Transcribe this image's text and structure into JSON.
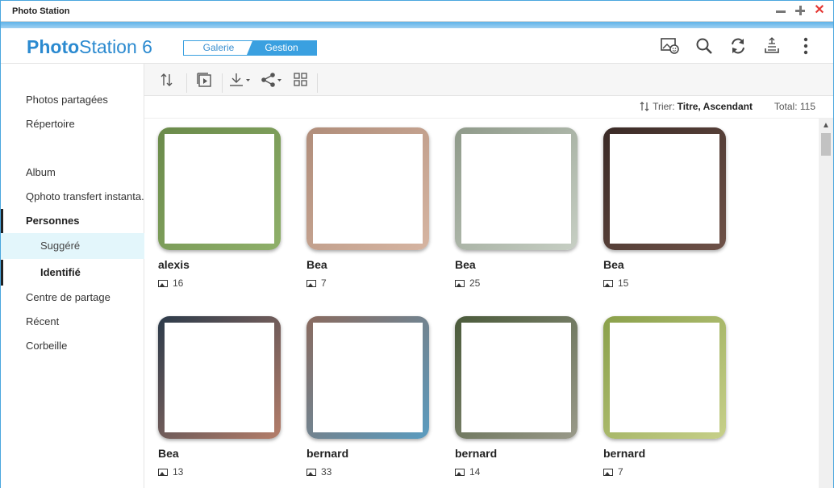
{
  "window": {
    "title": "Photo Station"
  },
  "header": {
    "logo_bold": "Photo",
    "logo_rest": "Station 6",
    "modes": [
      "Galerie",
      "Gestion"
    ],
    "active_mode": "Gestion",
    "icons": [
      "face-recognition-icon",
      "search-icon",
      "refresh-icon",
      "upload-icon",
      "more-vertical-icon"
    ]
  },
  "sidebar": {
    "items": [
      {
        "label": "Photos partagées"
      },
      {
        "label": "Répertoire"
      },
      {
        "label": "Album"
      },
      {
        "label": "Qphoto transfert instanta..."
      },
      {
        "label": "Personnes"
      },
      {
        "label": "Suggéré"
      },
      {
        "label": "Identifié"
      },
      {
        "label": "Centre de partage"
      },
      {
        "label": "Récent"
      },
      {
        "label": "Corbeille"
      }
    ]
  },
  "toolbar": {
    "icons": [
      "sort-icon",
      "slideshow-icon",
      "download-icon",
      "share-icon",
      "grid-view-icon"
    ]
  },
  "sortbar": {
    "sort_prefix": "Trier:",
    "sort_value": "Titre, Ascendant",
    "total": "Total: 115"
  },
  "people": [
    {
      "name": "alexis",
      "count": "16",
      "colors": [
        "#6a8a4a",
        "#8fb06a"
      ]
    },
    {
      "name": "Bea",
      "count": "7",
      "colors": [
        "#b08d7a",
        "#d6b5a2"
      ]
    },
    {
      "name": "Bea",
      "count": "25",
      "colors": [
        "#8f9a8a",
        "#c7cfc4"
      ]
    },
    {
      "name": "Bea",
      "count": "15",
      "colors": [
        "#3a2a26",
        "#6f5248"
      ]
    },
    {
      "name": "Bea",
      "count": "13",
      "colors": [
        "#2b3a4a",
        "#b57e6a"
      ]
    },
    {
      "name": "bernard",
      "count": "33",
      "colors": [
        "#8a6a5e",
        "#5a9cc0"
      ]
    },
    {
      "name": "bernard",
      "count": "14",
      "colors": [
        "#4a5a3a",
        "#9a9a8a"
      ]
    },
    {
      "name": "bernard",
      "count": "7",
      "colors": [
        "#8aa04a",
        "#c7d08a"
      ]
    }
  ]
}
